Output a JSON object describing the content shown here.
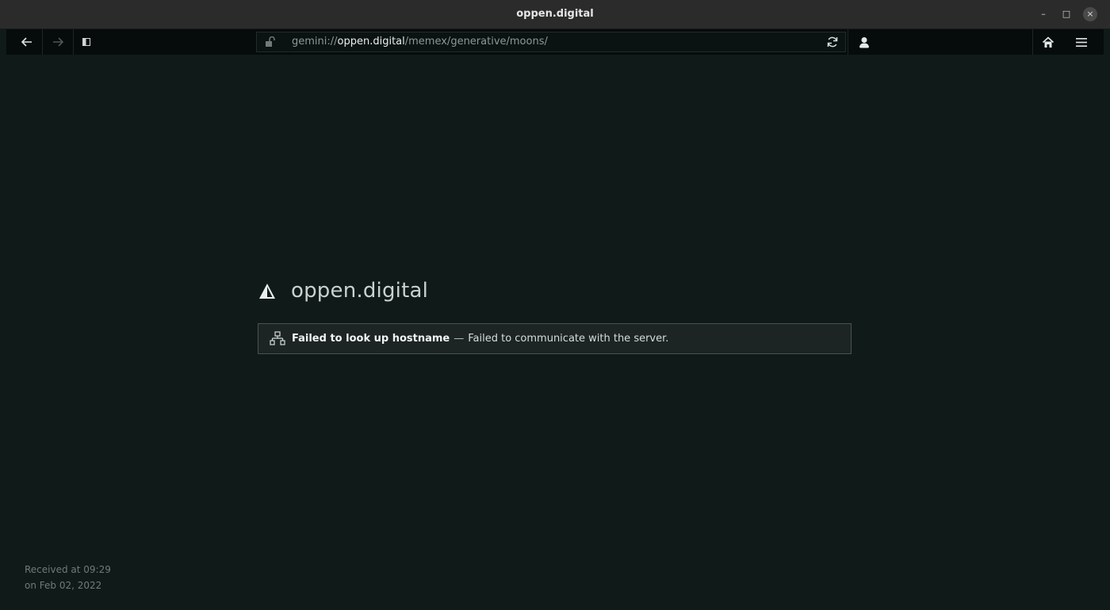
{
  "window": {
    "title": "oppen.digital",
    "minimize_glyph": "–",
    "maximize_glyph": "□",
    "close_glyph": "×"
  },
  "toolbar": {
    "url": {
      "scheme": "gemini://",
      "host": "oppen.digital",
      "path": "/memex/generative/moons/"
    },
    "icons": [
      "back-arrow-icon",
      "forward-arrow-icon",
      "sidebar-icon",
      "unlock-icon",
      "reload-icon",
      "identity-icon",
      "home-icon",
      "hamburger-menu-icon"
    ]
  },
  "page": {
    "hostname": "oppen.digital",
    "error": {
      "title": "Failed to look up hostname",
      "separator": "—",
      "message": "Failed to communicate with the server."
    },
    "received_line1": "Received at 09:29",
    "received_line2": "on Feb 02, 2022"
  },
  "colors": {
    "background": "#101a19",
    "toolbar": "#060b0b",
    "titlebar": "#2b2b2b",
    "banner": "#1c2424"
  }
}
